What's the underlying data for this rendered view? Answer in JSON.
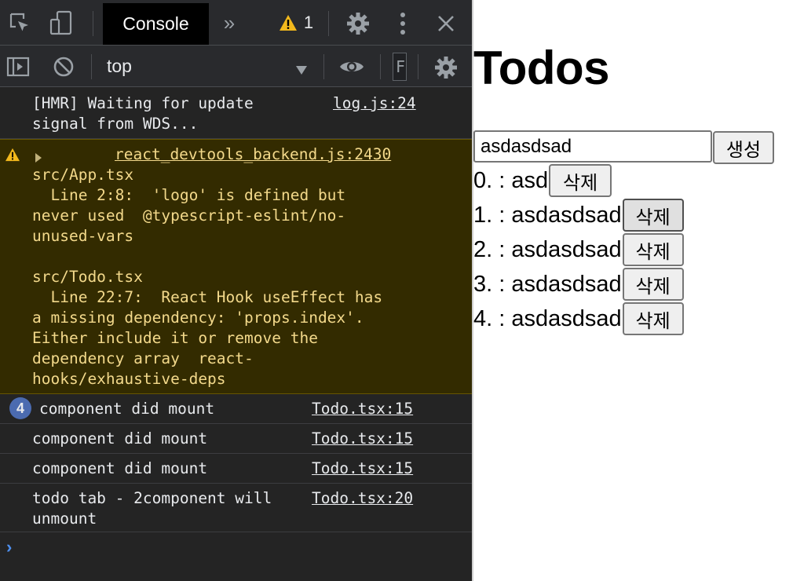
{
  "devtools": {
    "main_toolbar": {
      "tabs": [
        {
          "label": "Console",
          "active": true
        }
      ],
      "more_tabs_glyph": "»",
      "warning_count": "1",
      "icons": [
        "inspect-element-icon",
        "device-toolbar-icon",
        "warning-icon",
        "gear-icon",
        "kebab-menu-icon",
        "close-icon"
      ]
    },
    "console_toolbar": {
      "context": "top",
      "filter_value": "F",
      "icons": [
        "sidebar-toggle-icon",
        "clear-console-icon",
        "eye-icon",
        "gear-icon"
      ]
    },
    "messages": [
      {
        "type": "log",
        "text": "[HMR] Waiting for update\nsignal from WDS...",
        "source": "log.js:24"
      },
      {
        "type": "warning",
        "text": "src/App.tsx\n  Line 2:8:  'logo' is defined but\nnever used  @typescript-eslint/no-\nunused-vars\n\nsrc/Todo.tsx\n  Line 22:7:  React Hook useEffect has\na missing dependency: 'props.index'.\nEither include it or remove the\ndependency array  react-\nhooks/exhaustive-deps",
        "source": "react_devtools_backend.js:2430"
      },
      {
        "type": "log",
        "count": "4",
        "text": "component did mount",
        "source": "Todo.tsx:15"
      },
      {
        "type": "log",
        "text": "component did mount",
        "source": "Todo.tsx:15"
      },
      {
        "type": "log",
        "text": "component did mount",
        "source": "Todo.tsx:15"
      },
      {
        "type": "log",
        "text": "todo tab - 2component will\nunmount",
        "source": "Todo.tsx:20"
      }
    ],
    "prompt_glyph": "›",
    "colors": {
      "panel_bg": "#242424",
      "warning_bg": "#332b00",
      "warning_text": "#f3d98b",
      "badge": "#4b6bb0",
      "prompt": "#4d8fef"
    }
  },
  "page": {
    "title": "Todos",
    "input_value": "asdasdsad",
    "create_button": "생성",
    "todos": [
      {
        "label": "0. : asd",
        "delete_button": "삭제"
      },
      {
        "label": "1. : asdasdsad",
        "delete_button": "삭제"
      },
      {
        "label": "2. : asdasdsad",
        "delete_button": "삭제"
      },
      {
        "label": "3. : asdasdsad",
        "delete_button": "삭제"
      },
      {
        "label": "4. : asdasdsad",
        "delete_button": "삭제"
      }
    ]
  }
}
